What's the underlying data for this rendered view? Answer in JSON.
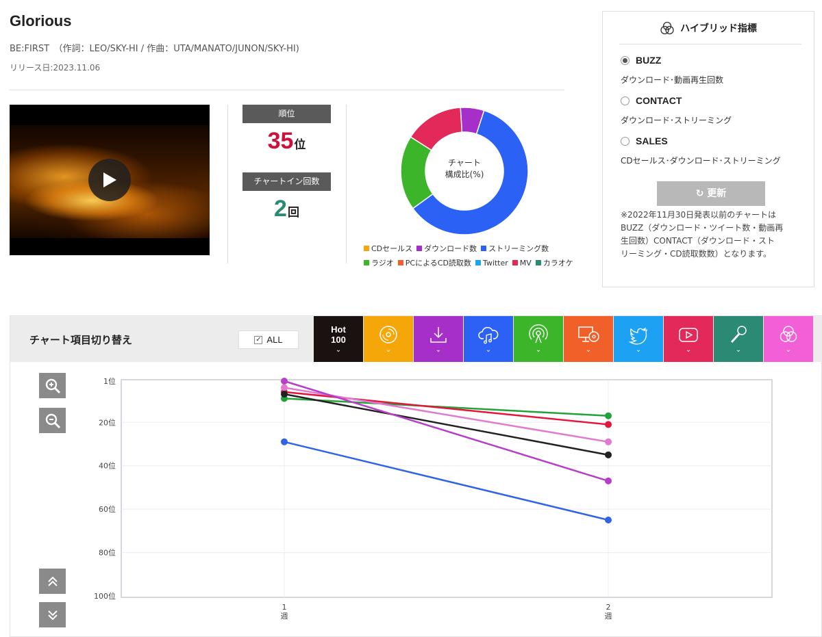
{
  "song": {
    "title": "Glorious",
    "credits": "BE:FIRST　（作詞：LEO/SKY-HI / 作曲：UTA/MANATO/JUNON/SKY-HI)",
    "release": "リリース日:2023.11.06"
  },
  "video": {
    "play_icon": "play-icon"
  },
  "rank": {
    "label": "順位",
    "value": "35",
    "unit": "位",
    "value_color": "#d0103a"
  },
  "chartin": {
    "label": "チャートイン回数",
    "value": "2",
    "unit": "回",
    "value_color": "#2a8a74"
  },
  "donut": {
    "center_line1": "チャート",
    "center_line2": "構成比(%)",
    "segments": [
      {
        "name": "ダウンロード数",
        "value": 6,
        "color": "#a62fc9"
      },
      {
        "name": "ストリーミング数",
        "value": 60,
        "color": "#2b61f5"
      },
      {
        "name": "ラジオ",
        "value": 19,
        "color": "#3cb52b"
      },
      {
        "name": "MV",
        "value": 15,
        "color": "#e3285a"
      }
    ]
  },
  "legend": {
    "row1": [
      {
        "label": "CDセールス",
        "color": "#f5a70a"
      },
      {
        "label": "ダウンロード数",
        "color": "#a62fc9"
      },
      {
        "label": "ストリーミング数",
        "color": "#2b61f5"
      }
    ],
    "row2": [
      {
        "label": "ラジオ",
        "color": "#3cb52b"
      },
      {
        "label": "PCによるCD読取数",
        "color": "#f2602a"
      },
      {
        "label": "Twitter",
        "color": "#1da1f2"
      },
      {
        "label": "MV",
        "color": "#e3285a"
      },
      {
        "label": "カラオケ",
        "color": "#2a8a74"
      }
    ]
  },
  "panel": {
    "title": "ハイブリッド指標",
    "title_icon": "hybrid-circles-icon",
    "options": [
      {
        "label": "BUZZ",
        "desc": "ダウンロード･動画再生回数",
        "selected": true
      },
      {
        "label": "CONTACT",
        "desc": "ダウンロード･ストリーミング",
        "selected": false
      },
      {
        "label": "SALES",
        "desc": "CDセールス･ダウンロード･ストリーミング",
        "selected": false
      }
    ],
    "refresh_label": "更新",
    "refresh_icon": "refresh-icon",
    "note_lines": [
      "※2022年11月30日発表以前のチャートは",
      "BUZZ（ダウンロード・ツイート数・動画再",
      "生回数）CONTACT（ダウンロード・スト",
      "リーミング・CD読取数数）となります。"
    ]
  },
  "toolbar": {
    "title": "チャート項目切り替え",
    "all_label": "ALL",
    "tabs": [
      {
        "name": "hot100",
        "line1": "Hot",
        "line2": "100",
        "color": "#1a1111"
      },
      {
        "name": "cd",
        "icon": "cd-icon",
        "color": "#f5a70a"
      },
      {
        "name": "download",
        "icon": "download-icon",
        "color": "#a62fc9"
      },
      {
        "name": "streaming",
        "icon": "cloud-music-icon",
        "color": "#2b61f5"
      },
      {
        "name": "radio",
        "icon": "radio-icon",
        "color": "#3cb52b"
      },
      {
        "name": "pc-cd",
        "icon": "pc-cd-icon",
        "color": "#f2602a"
      },
      {
        "name": "twitter",
        "icon": "twitter-icon",
        "color": "#1da1f2"
      },
      {
        "name": "mv",
        "icon": "youtube-icon",
        "color": "#e3285a"
      },
      {
        "name": "karaoke",
        "icon": "microphone-icon",
        "color": "#2a8a74"
      },
      {
        "name": "hybrid",
        "icon": "hybrid-circles-icon",
        "color": "#f25fd6"
      }
    ]
  },
  "chart_data": {
    "type": "line",
    "x": [
      1,
      2
    ],
    "x_tick_labels": [
      [
        "1",
        "週"
      ],
      [
        "2",
        "週"
      ]
    ],
    "y_tick_labels": [
      "1位",
      "20位",
      "40位",
      "60位",
      "80位",
      "100位"
    ],
    "y_ticks": [
      1,
      20,
      40,
      60,
      80,
      100
    ],
    "ylim": [
      1,
      100
    ],
    "y_inverted": true,
    "grid": true,
    "series": [
      {
        "color": "#22a33a",
        "values": [
          9,
          17
        ]
      },
      {
        "color": "#e3163c",
        "values": [
          6,
          21
        ]
      },
      {
        "color": "#e07ad0",
        "values": [
          4,
          29
        ]
      },
      {
        "color": "#222222",
        "values": [
          7,
          35
        ]
      },
      {
        "color": "#b63ec8",
        "values": [
          1,
          47
        ]
      },
      {
        "color": "#2f64e6",
        "values": [
          29,
          65
        ]
      }
    ]
  }
}
